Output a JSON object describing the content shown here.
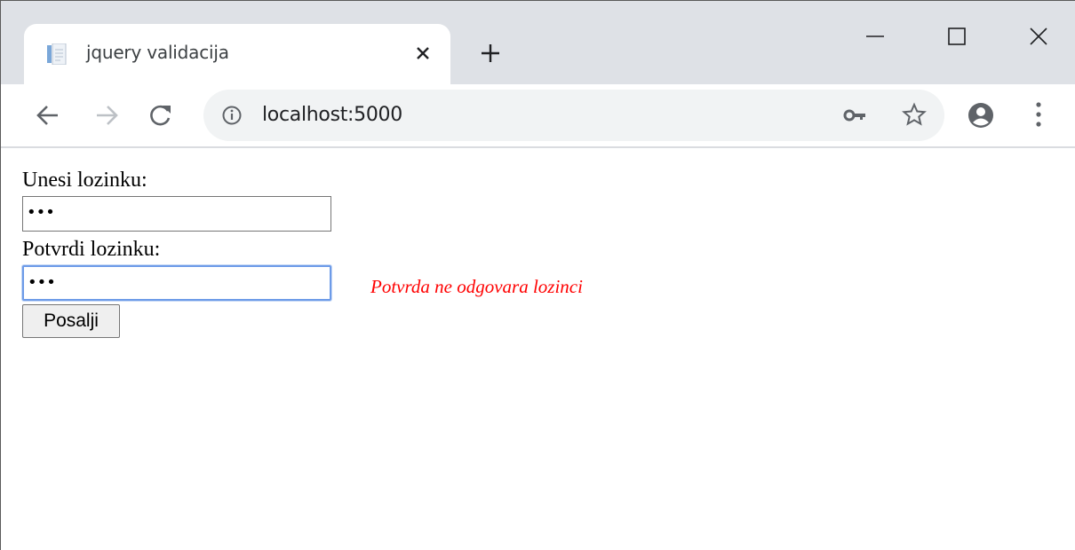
{
  "browser": {
    "tab": {
      "title": "jquery validacija",
      "favicon": "page-icon",
      "close_icon": "close-icon"
    },
    "new_tab_icon": "plus-icon",
    "window_controls": [
      "minimize-icon",
      "maximize-icon",
      "close-window-icon"
    ],
    "toolbar": {
      "back_icon": "arrow-left-icon",
      "forward_icon": "arrow-right-icon",
      "reload_icon": "reload-icon",
      "url": "localhost:5000",
      "site_info_icon": "info-icon",
      "password_icon": "key-icon",
      "bookmark_icon": "star-icon",
      "profile_icon": "account-icon",
      "menu_icon": "more-vert-icon"
    }
  },
  "form": {
    "password_label": "Unesi lozinku:",
    "password_value": "•••",
    "confirm_label": "Potvrdi lozinku:",
    "confirm_value": "•••",
    "error_message": "Potvrda ne odgovara lozinci",
    "submit_label": "Posalji"
  },
  "colors": {
    "tab_strip": "#dee1e6",
    "omnibox": "#f1f3f4",
    "error_text": "#ff0000",
    "focus_ring": "#6d9be8"
  }
}
